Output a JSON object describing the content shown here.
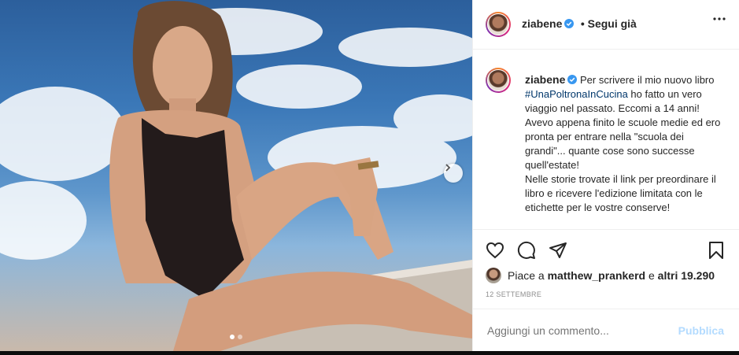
{
  "post": {
    "image_description_icon": "photo-icon",
    "carousel": {
      "total_slides": 2,
      "current_slide": 1
    }
  },
  "header": {
    "username": "ziabene",
    "follow_label": "• Segui già"
  },
  "caption": {
    "username": "ziabene",
    "text_before": "Per scrivere il mio nuovo libro ",
    "hashtag": "#UnaPoltronaInCucina",
    "text_after": " ho fatto un vero viaggio nel passato. Eccomi  a 14 anni! Avevo appena finito le scuole medie ed ero pronta per entrare nella \"scuola dei grandi\"... quante cose sono successe quell'estate!\nNelle storie trovate il link per preordinare il libro e ricevere l'edizione limitata con le etichette per le vostre conserve!"
  },
  "likes": {
    "prefix": "Piace a",
    "user": "matthew_prankerd",
    "connector": "e",
    "others": "altri 19.290"
  },
  "date": "12 SETTEMBRE",
  "comment": {
    "placeholder": "Aggiungi un commento...",
    "publish_label": "Pubblica"
  },
  "colors": {
    "link": "#00376b",
    "verified": "#3897f0",
    "publish_disabled": "#b3dbff"
  }
}
